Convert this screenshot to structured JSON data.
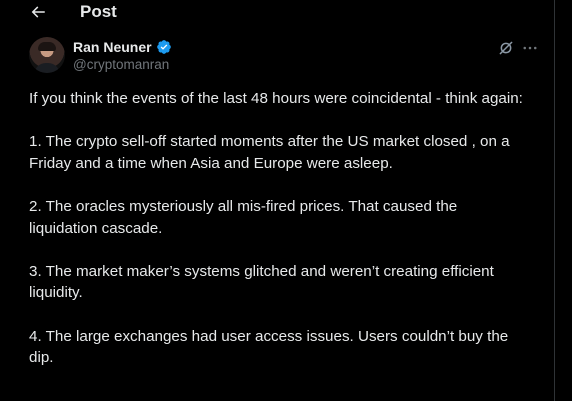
{
  "header": {
    "title": "Post",
    "back_icon": "arrow-left-icon"
  },
  "author": {
    "name": "Ran Neuner",
    "handle": "@cryptomanran",
    "verified": true,
    "verified_color": "#1d9bf0"
  },
  "actions": {
    "grok_icon": "grok-icon",
    "more_icon": "more-horizontal-icon"
  },
  "tweet": {
    "paragraphs": [
      "If you think the events of the last 48 hours were coincidental - think again:",
      "1. The crypto sell-off started moments after the US market closed , on a Friday and a time when Asia and Europe were asleep.",
      "2. The oracles mysteriously all mis-fired prices. That caused the liquidation cascade.",
      "3. The market maker’s systems glitched and weren’t creating efficient liquidity.",
      "4. The large exchanges had user access issues. Users couldn’t buy the dip."
    ]
  },
  "theme": {
    "background": "#000000",
    "text": "#e7e9ea",
    "muted": "#71767b",
    "border": "#2f3336"
  }
}
